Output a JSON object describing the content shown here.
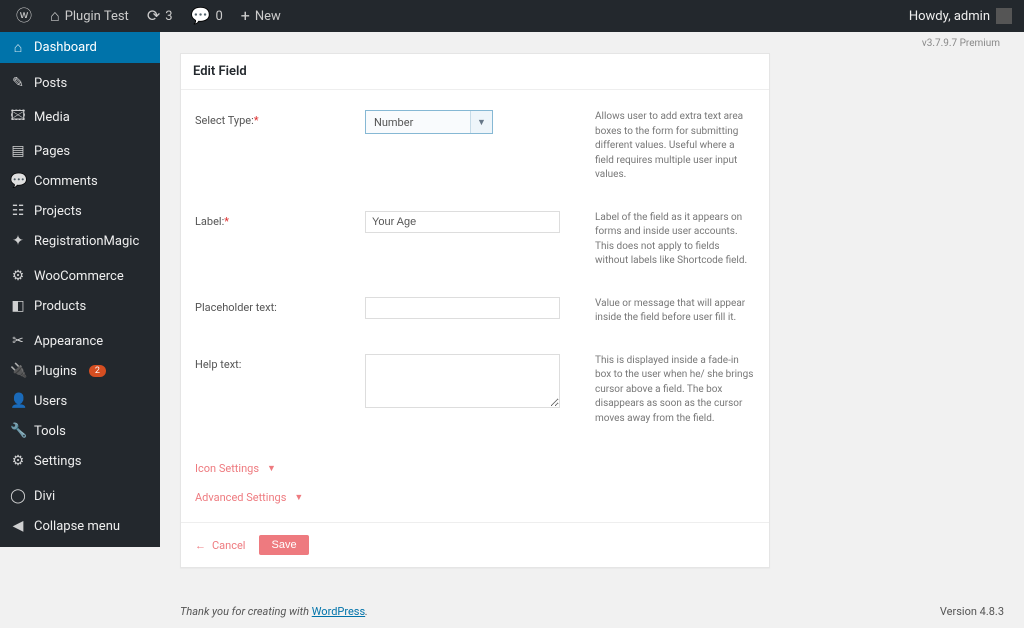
{
  "adminBar": {
    "siteName": "Plugin Test",
    "updates": "3",
    "comments": "0",
    "newLabel": "New",
    "howdy": "Howdy, admin"
  },
  "sidebar": {
    "items": [
      {
        "label": "Dashboard",
        "icon": "⌂",
        "current": true
      },
      {
        "label": "Posts",
        "icon": "✎"
      },
      {
        "label": "Media",
        "icon": "🖾"
      },
      {
        "label": "Pages",
        "icon": "▤"
      },
      {
        "label": "Comments",
        "icon": "💬"
      },
      {
        "label": "Projects",
        "icon": "☷"
      },
      {
        "label": "RegistrationMagic",
        "icon": "✦"
      },
      {
        "label": "WooCommerce",
        "icon": "⚙"
      },
      {
        "label": "Products",
        "icon": "◧"
      },
      {
        "label": "Appearance",
        "icon": "✂"
      },
      {
        "label": "Plugins",
        "icon": "🔌",
        "badge": "2"
      },
      {
        "label": "Users",
        "icon": "👤"
      },
      {
        "label": "Tools",
        "icon": "🔧"
      },
      {
        "label": "Settings",
        "icon": "⚙"
      },
      {
        "label": "Divi",
        "icon": "◯"
      },
      {
        "label": "Collapse menu",
        "icon": "◀"
      }
    ]
  },
  "versionTag": "v3.7.9.7 Premium",
  "panel": {
    "title": "Edit Field",
    "fields": {
      "selectType": {
        "label": "Select Type:",
        "value": "Number",
        "help": "Allows user to add extra text area boxes to the form for submitting different values. Useful where a field requires multiple user input values."
      },
      "label": {
        "label": "Label:",
        "value": "Your Age",
        "help": "Label of the field as it appears on forms and inside user accounts. This does not apply to fields without labels like Shortcode field."
      },
      "placeholder": {
        "label": "Placeholder text:",
        "value": "",
        "help": "Value or message that will appear inside the field before user fill it."
      },
      "helpText": {
        "label": "Help text:",
        "value": "",
        "help": "This is displayed inside a fade-in box to the user when he/ she brings cursor above a field. The box disappears as soon as the cursor moves away from the field."
      }
    },
    "accordions": {
      "icon": "Icon Settings",
      "advanced": "Advanced Settings"
    },
    "footer": {
      "cancel": "Cancel",
      "save": "Save"
    }
  },
  "footer": {
    "thanks_prefix": "Thank you for creating with ",
    "thanks_link": "WordPress",
    "thanks_suffix": ".",
    "version": "Version 4.8.3"
  }
}
